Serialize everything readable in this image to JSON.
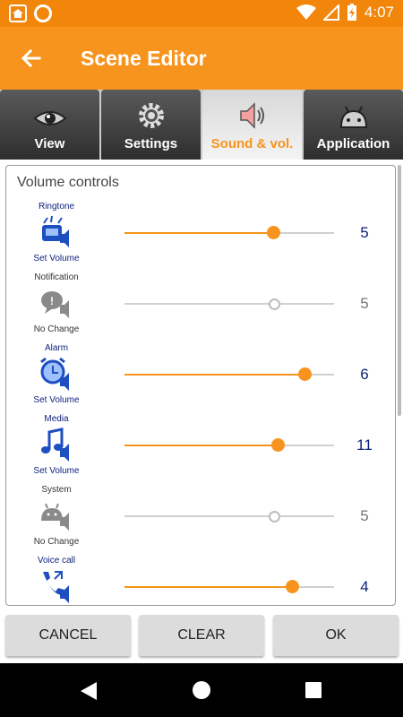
{
  "status_bar": {
    "time": "4:07"
  },
  "toolbar": {
    "title": "Scene Editor"
  },
  "tabs": [
    {
      "label": "View",
      "icon": "eye-icon",
      "active": false
    },
    {
      "label": "Settings",
      "icon": "gear-icon",
      "active": false
    },
    {
      "label": "Sound & vol.",
      "icon": "speaker-icon",
      "active": true
    },
    {
      "label": "Application",
      "icon": "android-icon",
      "active": false
    }
  ],
  "section_title": "Volume controls",
  "rows": [
    {
      "name": "Ringtone",
      "action": "Set Volume",
      "value": "5",
      "level_fraction": 0.71,
      "active": true,
      "icon": "ringing-phone-icon"
    },
    {
      "name": "Notification",
      "action": "No Change",
      "value": "5",
      "level_fraction": 0.71,
      "active": false,
      "icon": "notification-icon"
    },
    {
      "name": "Alarm",
      "action": "Set Volume",
      "value": "6",
      "level_fraction": 0.86,
      "active": true,
      "icon": "alarm-clock-icon"
    },
    {
      "name": "Media",
      "action": "Set Volume",
      "value": "11",
      "level_fraction": 0.73,
      "active": true,
      "icon": "music-note-icon"
    },
    {
      "name": "System",
      "action": "No Change",
      "value": "5",
      "level_fraction": 0.71,
      "active": false,
      "icon": "android-system-icon"
    },
    {
      "name": "Voice call",
      "action": "",
      "value": "4",
      "level_fraction": 0.8,
      "active": true,
      "icon": "phone-call-icon"
    }
  ],
  "buttons": {
    "cancel": "CANCEL",
    "clear": "CLEAR",
    "ok": "OK"
  },
  "colors": {
    "accent": "#f7941d",
    "statusbar": "#f2860b",
    "label": "#0b1f7a"
  }
}
